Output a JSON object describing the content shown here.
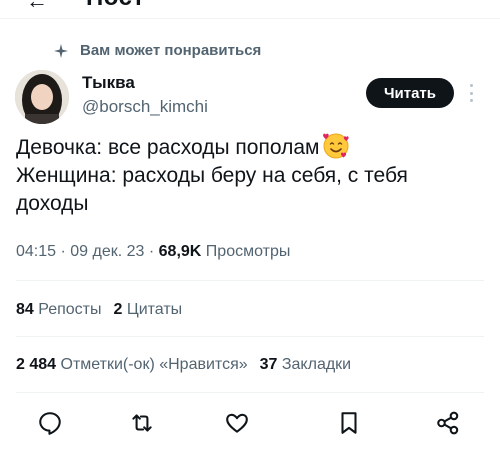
{
  "header": {
    "back_icon": "arrow-left-icon",
    "title": "Пост"
  },
  "suggestion": {
    "icon": "sparkle-icon",
    "text": "Вам может понравиться"
  },
  "author": {
    "name": "Тыква",
    "handle": "@borsch_kimchi",
    "avatar": "avatar-photo"
  },
  "follow_button": {
    "label": "Читать"
  },
  "tweet": {
    "lines": [
      "Девочка: все расходы пополам",
      "Женщина: расходы беру на себя, с тебя",
      "доходы"
    ],
    "emoji": "smiling-face-with-hearts-emoji"
  },
  "meta": {
    "time": "04:15",
    "sep1": " · ",
    "date": "09 дек. 23",
    "sep2": " · ",
    "views_count": "68,9K",
    "views_label": " Просмотры"
  },
  "stats_row1": {
    "reposts_count": "84",
    "reposts_label": " Репосты",
    "quotes_count": "2",
    "quotes_label": " Цитаты"
  },
  "stats_row2": {
    "likes_count": "2 484",
    "likes_label": " Отметки(-ок) «Нравится»",
    "bookmarks_count": "37",
    "bookmarks_label": " Закладки"
  },
  "actions": [
    "reply-icon",
    "repost-icon",
    "like-icon",
    "bookmark-icon",
    "share-icon"
  ],
  "colors": {
    "text": "#0f1419",
    "secondary": "#536471",
    "button_bg": "#0f1419",
    "divider": "#eff3f4"
  }
}
